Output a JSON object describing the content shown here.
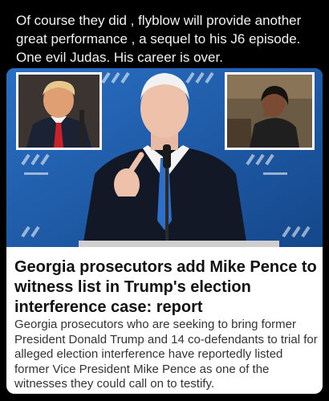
{
  "post": {
    "text": "Of course they did , flyblow will provide another great performance , a sequel to his J6 episode. One evil Judas. His career is over."
  },
  "article": {
    "headline": "Georgia prosecutors add Mike Pence to witness list in Trump's election interference case: report",
    "summary": "Georgia prosecutors who are seeking to bring former President Donald Trump and 14 co-defendants to trial for alleged election interference have reportedly listed former Vice President Mike Pence as one of the witnesses they could call on to testify."
  },
  "colors": {
    "backdrop_blue": "#1e5fb0",
    "page_background": "#000000",
    "card_background": "#ffffff"
  }
}
